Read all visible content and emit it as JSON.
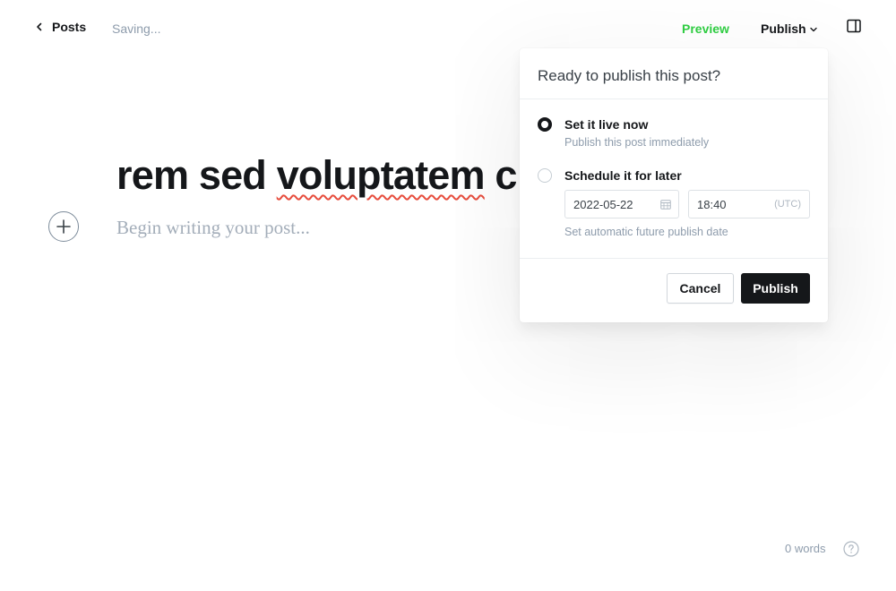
{
  "topbar": {
    "back_label": "Posts",
    "status": "Saving...",
    "preview_label": "Preview",
    "publish_label": "Publish"
  },
  "editor": {
    "title_part1": "rem sed ",
    "title_word_underlined": "voluptatem",
    "title_part2": " c",
    "body_placeholder": "Begin writing your post..."
  },
  "publish_popover": {
    "title": "Ready to publish this post?",
    "options": [
      {
        "label": "Set it live now",
        "description": "Publish this post immediately",
        "selected": true
      },
      {
        "label": "Schedule it for later",
        "description": "",
        "selected": false
      }
    ],
    "date_value": "2022-05-22",
    "time_value": "18:40",
    "timezone": "(UTC)",
    "help_text": "Set automatic future publish date",
    "cancel_label": "Cancel",
    "publish_label": "Publish"
  },
  "footer": {
    "word_count": "0 words"
  },
  "colors": {
    "accent_green": "#30cf43",
    "primary_dark": "#15171a",
    "muted": "#8e9cac"
  },
  "icons": [
    "chevron-left-icon",
    "chevron-down-icon",
    "sidebar-toggle-icon",
    "plus-icon",
    "calendar-icon",
    "help-icon"
  ]
}
